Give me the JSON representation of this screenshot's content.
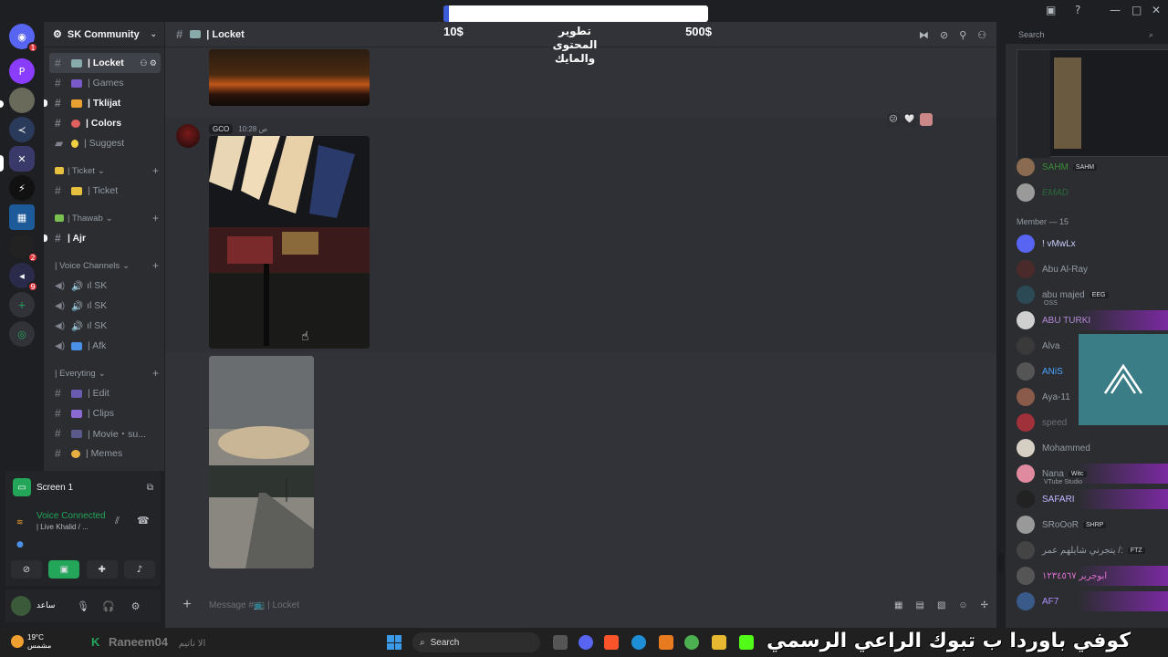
{
  "server": {
    "name": "SK Community"
  },
  "channels": [
    {
      "label": "| Locket",
      "type": "text",
      "active": true
    },
    {
      "label": "| Games",
      "type": "text"
    },
    {
      "label": "| Tklijat",
      "type": "text",
      "bold": true
    },
    {
      "label": "| Colors",
      "type": "text",
      "bold": true
    },
    {
      "label": "| Suggest",
      "type": "text"
    },
    {
      "label": "| Ticket",
      "type": "text",
      "category": "| Ticket"
    },
    {
      "label": "| Ajr",
      "type": "text",
      "category": "| Thawab",
      "bold": true
    },
    {
      "label": "ıl SK",
      "type": "voice"
    },
    {
      "label": "ıl SK",
      "type": "voice"
    },
    {
      "label": "ıl SK",
      "type": "voice"
    },
    {
      "label": "| Afk",
      "type": "voice"
    },
    {
      "label": "| Edit",
      "type": "text"
    },
    {
      "label": "| Clips",
      "type": "text"
    },
    {
      "label": "| Movie・su...",
      "type": "text"
    },
    {
      "label": "| Memes",
      "type": "text"
    }
  ],
  "categories": {
    "ticket": "| Ticket",
    "thawab": "| Thawab",
    "voice": "| Voice Channels",
    "everyting": "| Everyting"
  },
  "voice_panel": {
    "screen_title": "Screen 1",
    "status": "Voice Connected",
    "channel": "| Live Khalid / ..."
  },
  "chat": {
    "channel_title": "| Locket",
    "composer_placeholder": "Message #📺 | Locket",
    "message_meta": {
      "tag": "GCO",
      "time": "10:28 ص"
    }
  },
  "overlay": {
    "progress_fraction": 0.02,
    "left_amount": "10$",
    "right_amount": "500$",
    "center_line1": "تطوير",
    "center_line2": "المحتوى",
    "center_line3": "والمايك"
  },
  "search": {
    "placeholder": "Search"
  },
  "members": {
    "role_header": "Member — 15",
    "top": [
      {
        "name": "SAHM",
        "tag": "SAHM"
      },
      {
        "name": "EMAD"
      }
    ],
    "list": [
      {
        "name": "! vMwLx",
        "color": "#c9cdfb",
        "avatar": "#5865f2"
      },
      {
        "name": "Abu Al-Ray",
        "color": "#949ba4",
        "avatar": "#4a2a2a"
      },
      {
        "name": "abu majed",
        "tag": "EEG",
        "sub": "OSS",
        "color": "#949ba4",
        "avatar": "#2b4a55"
      },
      {
        "name": "ABU TURKI",
        "color": "#b58bd8",
        "avatar": "#d0d0d0",
        "grad": true
      },
      {
        "name": "Alva",
        "color": "#949ba4",
        "avatar": "#3a3a3a"
      },
      {
        "name": "ANiS",
        "color": "#4aa3ff",
        "avatar": "#555"
      },
      {
        "name": "Aya-11",
        "color": "#949ba4",
        "avatar": "#8a5a4a"
      },
      {
        "name": "speed",
        "color": "#6d6f78",
        "avatar": "#a0303a"
      },
      {
        "name": "Mohammed",
        "color": "#949ba4",
        "avatar": "#d6d0c4"
      },
      {
        "name": "Nana",
        "tag": "Witc",
        "sub": "VTube Studio",
        "color": "#949ba4",
        "avatar": "#e08aa0",
        "grad": true
      },
      {
        "name": "SAFARI",
        "color": "#c0b6ff",
        "avatar": "#222",
        "grad": true
      },
      {
        "name": "SRoOoR",
        "tag": "SHRP",
        "color": "#949ba4",
        "avatar": "#999"
      },
      {
        "name": "يتجرني شايلهم عمر /:",
        "tag": "FTZ",
        "color": "#949ba4",
        "avatar": "#444"
      },
      {
        "name": "ابوجرير ١٢٣٤٥٦٧",
        "color": "#e070d0",
        "avatar": "#555",
        "grad": true
      },
      {
        "name": "AF7",
        "color": "#b090ff",
        "avatar": "#3a5a8a",
        "grad": true
      }
    ]
  },
  "taskbar": {
    "temperature": "19°C",
    "weather": "مشمس",
    "user": "Raneem04",
    "user_suffix": "الا ناتيم",
    "search": "Search",
    "ticker": "كوفي باوردا ب تبوك الراعي الرسمي"
  },
  "icons": {
    "discord": "discord-icon",
    "hash": "hash-icon",
    "gear": "gear-icon",
    "speaker": "speaker-icon",
    "mic": "mic-icon",
    "headphones": "headphones-icon",
    "search": "search-icon",
    "pin": "pin-icon",
    "members": "members-icon",
    "plus": "plus-icon",
    "gift": "gift-icon",
    "emoji": "emoji-icon"
  },
  "colors": {
    "accent": "#5865f2",
    "online": "#23a55a",
    "danger": "#da373c",
    "progress": "#3b5bd9"
  }
}
